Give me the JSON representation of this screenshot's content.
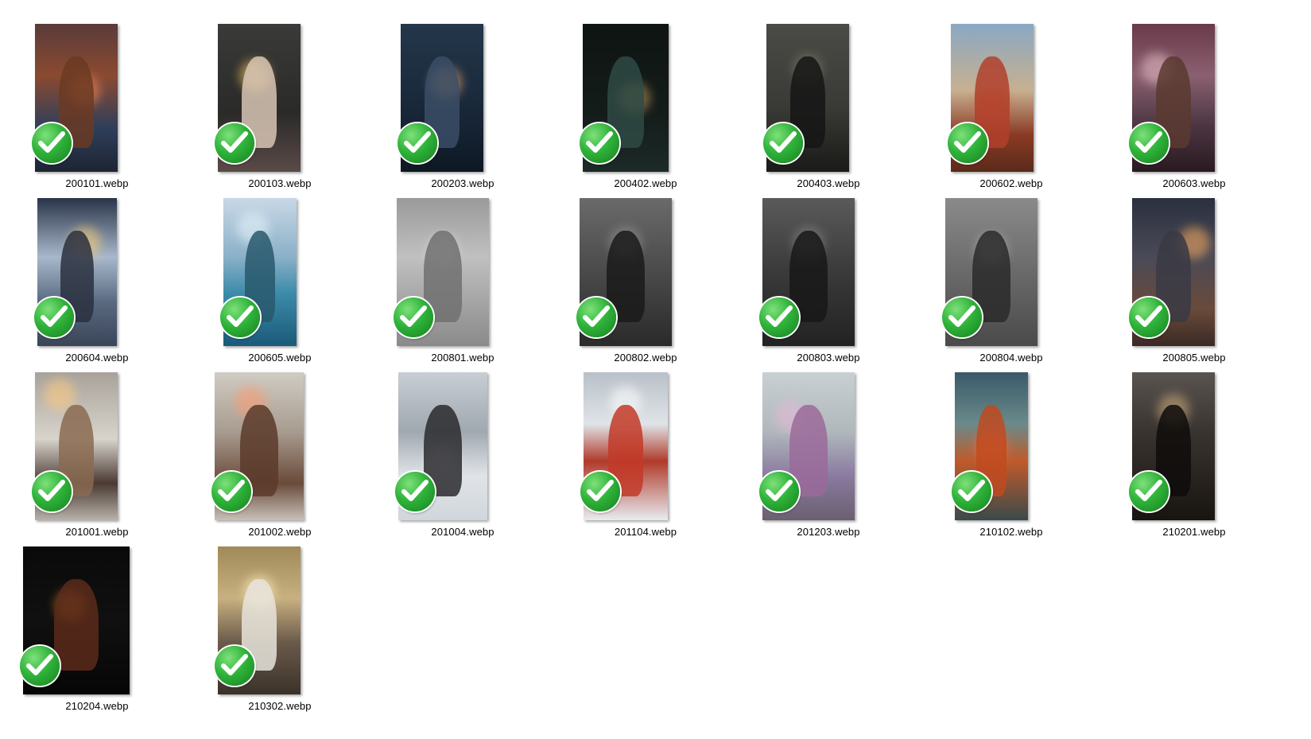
{
  "files": [
    {
      "name": "200101.webp",
      "selected": true
    },
    {
      "name": "200103.webp",
      "selected": true
    },
    {
      "name": "200203.webp",
      "selected": true
    },
    {
      "name": "200402.webp",
      "selected": true
    },
    {
      "name": "200403.webp",
      "selected": true
    },
    {
      "name": "200602.webp",
      "selected": true
    },
    {
      "name": "200603.webp",
      "selected": true
    },
    {
      "name": "200604.webp",
      "selected": true
    },
    {
      "name": "200605.webp",
      "selected": true
    },
    {
      "name": "200801.webp",
      "selected": true
    },
    {
      "name": "200802.webp",
      "selected": true
    },
    {
      "name": "200803.webp",
      "selected": true
    },
    {
      "name": "200804.webp",
      "selected": true
    },
    {
      "name": "200805.webp",
      "selected": true
    },
    {
      "name": "201001.webp",
      "selected": true
    },
    {
      "name": "201002.webp",
      "selected": true
    },
    {
      "name": "201004.webp",
      "selected": true
    },
    {
      "name": "201104.webp",
      "selected": true
    },
    {
      "name": "201203.webp",
      "selected": true
    },
    {
      "name": "210102.webp",
      "selected": true
    },
    {
      "name": "210201.webp",
      "selected": true
    },
    {
      "name": "210204.webp",
      "selected": true
    },
    {
      "name": "210302.webp",
      "selected": true
    }
  ],
  "icons": {
    "selection_badge": "green-checkmark-icon"
  },
  "colors": {
    "check_green": "#2fb33a",
    "label_text": "#000000",
    "background": "#ffffff"
  }
}
